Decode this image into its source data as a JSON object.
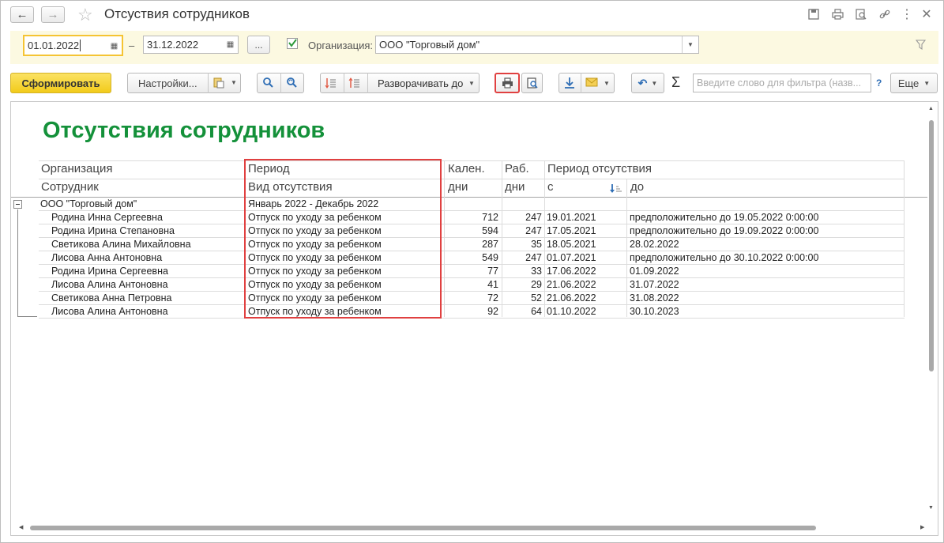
{
  "window": {
    "title": "Отсуствия сотрудников"
  },
  "filters": {
    "date_from": "01.01.2022",
    "date_dash": "–",
    "date_to": "31.12.2022",
    "period_btn": "...",
    "org_label": "Организация:",
    "org_value": "ООО \"Торговый дом\"",
    "org_checked": true
  },
  "toolbar": {
    "generate": "Сформировать",
    "settings": "Настройки...",
    "expand": "Разворачивать до",
    "search_placeholder": "Введите слово для фильтра (назв...",
    "help": "?",
    "more": "Еще"
  },
  "report": {
    "title": "Отсутствия сотрудников",
    "headers": {
      "org": "Организация",
      "employee": "Сотрудник",
      "period": "Период",
      "absence_type": "Вид отсутствия",
      "cal_days_1": "Кален.",
      "cal_days_2": "дни",
      "work_days_1": "Раб.",
      "work_days_2": "дни",
      "absence_period": "Период отсутствия",
      "from": "с",
      "to": "до"
    },
    "group": {
      "org": "ООО \"Торговый дом\"",
      "period": "Январь 2022 - Декабрь 2022"
    },
    "rows": [
      {
        "employee": "Родина Инна Сергеевна",
        "type": "Отпуск по уходу за ребенком",
        "cal": "712",
        "work": "247",
        "from": "19.01.2021",
        "to": "предположительно до 19.05.2022 0:00:00"
      },
      {
        "employee": "Родина Ирина Степановна",
        "type": "Отпуск по уходу за ребенком",
        "cal": "594",
        "work": "247",
        "from": "17.05.2021",
        "to": "предположительно до 19.09.2022 0:00:00"
      },
      {
        "employee": "Светикова Алина Михайловна",
        "type": "Отпуск по уходу за ребенком",
        "cal": "287",
        "work": "35",
        "from": "18.05.2021",
        "to": "28.02.2022"
      },
      {
        "employee": "Лисова Анна Антоновна",
        "type": "Отпуск по уходу за ребенком",
        "cal": "549",
        "work": "247",
        "from": "01.07.2021",
        "to": "предположительно до 30.10.2022 0:00:00"
      },
      {
        "employee": "Родина Ирина Сергеевна",
        "type": "Отпуск по уходу за ребенком",
        "cal": "77",
        "work": "33",
        "from": "17.06.2022",
        "to": "01.09.2022"
      },
      {
        "employee": "Лисова Алина Антоновна",
        "type": "Отпуск по уходу за ребенком",
        "cal": "41",
        "work": "29",
        "from": "21.06.2022",
        "to": "31.07.2022"
      },
      {
        "employee": "Светикова Анна Петровна",
        "type": "Отпуск по уходу за ребенком",
        "cal": "72",
        "work": "52",
        "from": "21.06.2022",
        "to": "31.08.2022"
      },
      {
        "employee": "Лисова Алина Антоновна",
        "type": "Отпуск по уходу за ребенком",
        "cal": "92",
        "work": "64",
        "from": "01.10.2022",
        "to": "30.10.2023"
      }
    ]
  },
  "colors": {
    "accent_yellow": "#f6d93a",
    "title_green": "#14913a",
    "highlight_red": "#e04040"
  }
}
